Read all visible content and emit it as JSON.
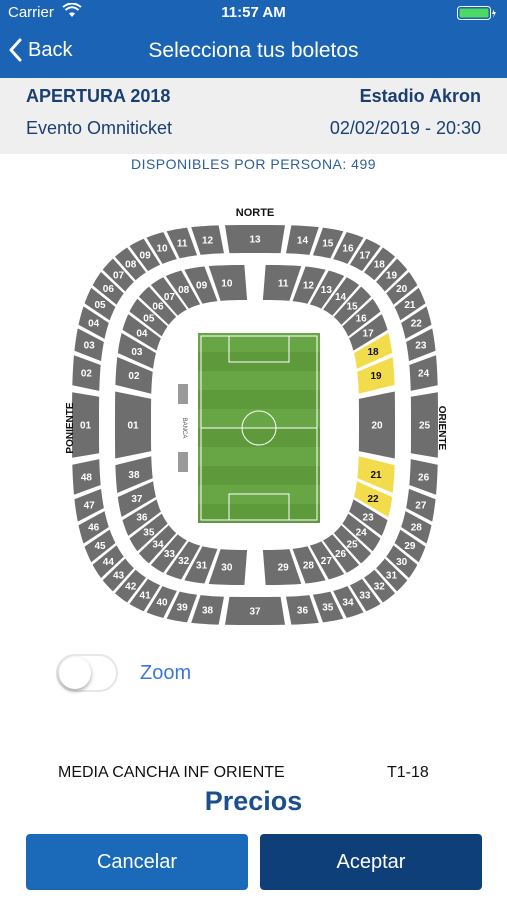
{
  "status_bar": {
    "carrier": "Carrier",
    "time": "11:57 AM"
  },
  "nav": {
    "back_label": "Back",
    "title": "Selecciona tus boletos"
  },
  "event": {
    "name": "APERTURA 2018",
    "venue": "Estadio Akron",
    "subtitle": "Evento Omniticket",
    "datetime": "02/02/2019 - 20:30"
  },
  "availability": "DISPONIBLES POR PERSONA: 499",
  "stadium": {
    "labels": {
      "north": "NORTE",
      "west": "PONIENTE",
      "east": "ORIENTE"
    },
    "bench_text": "BANCA",
    "colors": {
      "section": "#6e6e6e",
      "highlight": "#f2dc4c",
      "field": "#5e9a3b",
      "field_stripe": "#68a645"
    },
    "lower_sections": [
      "01",
      "02",
      "03",
      "04",
      "05",
      "06",
      "07",
      "08",
      "09",
      "10",
      "11",
      "12",
      "13",
      "14",
      "15",
      "16",
      "17",
      "18",
      "19",
      "20",
      "21",
      "22",
      "23",
      "24",
      "25",
      "26",
      "27",
      "28",
      "29",
      "30",
      "31",
      "32",
      "33",
      "34",
      "35",
      "36",
      "37",
      "38"
    ],
    "upper_sections": [
      "01",
      "02",
      "03",
      "04",
      "05",
      "06",
      "07",
      "08",
      "09",
      "10",
      "11",
      "12",
      "13",
      "14",
      "15",
      "16",
      "17",
      "18",
      "19",
      "20",
      "21",
      "22",
      "23",
      "24",
      "25",
      "26",
      "27",
      "28",
      "29",
      "30",
      "31",
      "32",
      "33",
      "34",
      "35",
      "36",
      "37",
      "38",
      "39",
      "40",
      "41",
      "42",
      "43",
      "44",
      "45",
      "46",
      "47",
      "48"
    ],
    "highlighted_sections": [
      "18",
      "19",
      "21",
      "22"
    ]
  },
  "zoom": {
    "label": "Zoom",
    "enabled": false
  },
  "selection": {
    "section_name": "MEDIA CANCHA INF ORIENTE",
    "section_code": "T1-18"
  },
  "prices_label": "Precios",
  "buttons": {
    "cancel": "Cancelar",
    "accept": "Aceptar"
  }
}
